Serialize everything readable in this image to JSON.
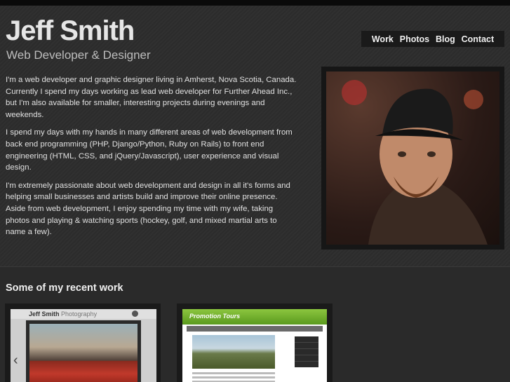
{
  "header": {
    "name": "Jeff Smith",
    "tagline": "Web Developer & Designer"
  },
  "nav": {
    "items": [
      "Work",
      "Photos",
      "Blog",
      "Contact"
    ]
  },
  "bio": {
    "paragraphs": [
      "I'm a web developer and graphic designer living in Amherst, Nova Scotia, Canada. Currently I spend my days working as lead web developer for Further Ahead Inc., but I'm also available for smaller, interesting projects during evenings and weekends.",
      "I spend my days with my hands in many different areas of web development from back end programming (PHP, Django/Python, Ruby on Rails) to front end engineering (HTML, CSS, and jQuery/Javascript), user experience and visual design.",
      "I'm extremely passionate about web development and design in all it's forms and helping small businesses and artists build and improve their online presence. Aside from web development, I enjoy spending my time with my wife, taking photos and playing & watching sports (hockey, golf, and mixed martial arts to name a few)."
    ]
  },
  "work": {
    "title": "Some of my recent work",
    "items": [
      {
        "site_title_bold": "Jeff Smith",
        "site_title_light": "Photography"
      },
      {
        "site_title": "Promotion Tours"
      }
    ]
  },
  "colors": {
    "background": "#2e2e2e",
    "nav_bg": "#1a1a1a",
    "accent_green": "#8cc63f"
  }
}
